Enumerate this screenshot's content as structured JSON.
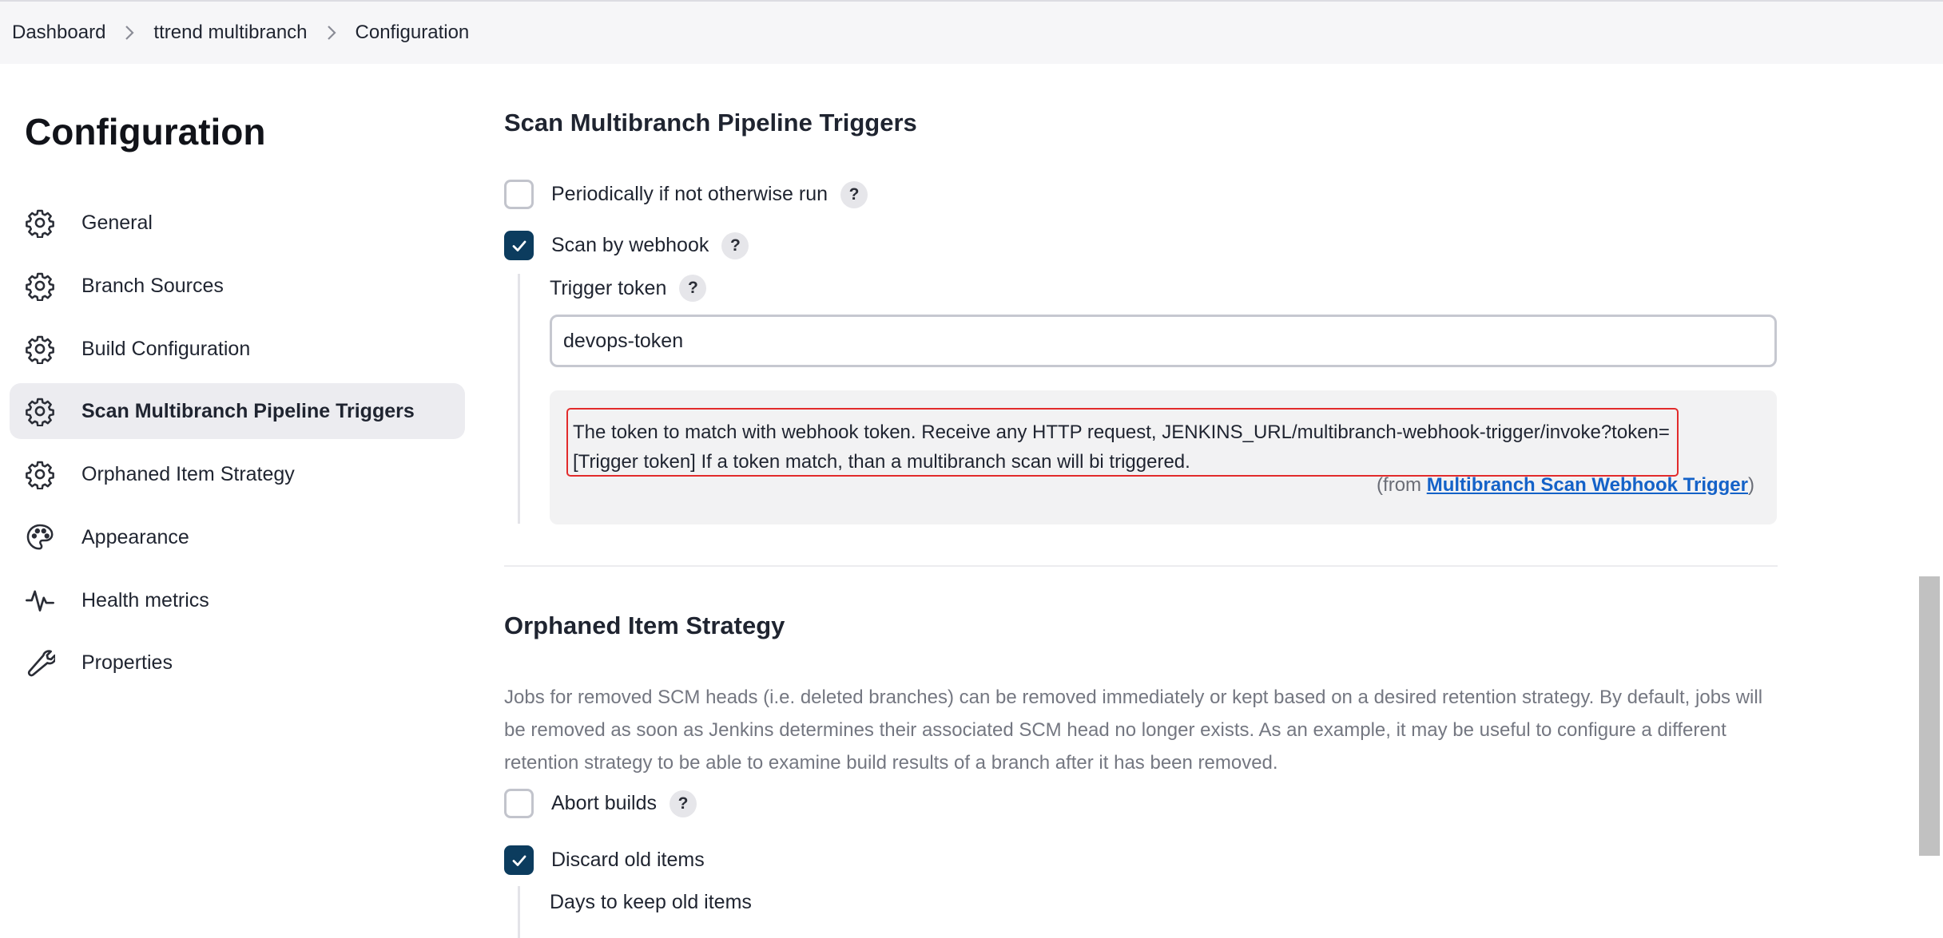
{
  "breadcrumb": {
    "items": [
      "Dashboard",
      "ttrend multibranch",
      "Configuration"
    ]
  },
  "sidebar": {
    "title": "Configuration",
    "items": [
      {
        "label": "General",
        "icon": "gear-icon"
      },
      {
        "label": "Branch Sources",
        "icon": "gear-icon"
      },
      {
        "label": "Build Configuration",
        "icon": "gear-icon"
      },
      {
        "label": "Scan Multibranch Pipeline Triggers",
        "icon": "gear-icon",
        "active": true
      },
      {
        "label": "Orphaned Item Strategy",
        "icon": "gear-icon"
      },
      {
        "label": "Appearance",
        "icon": "palette-icon"
      },
      {
        "label": "Health metrics",
        "icon": "pulse-icon"
      },
      {
        "label": "Properties",
        "icon": "wrench-icon"
      }
    ]
  },
  "triggers": {
    "title": "Scan Multibranch Pipeline Triggers",
    "periodically": {
      "label": "Periodically if not otherwise run",
      "checked": false
    },
    "webhook": {
      "label": "Scan by webhook",
      "checked": true
    },
    "token_label": "Trigger token",
    "token_value": "devops-token",
    "help_line1": "The token to match with webhook token. Receive any HTTP request, JENKINS_URL/multibranch-webhook-trigger/invoke?token=",
    "help_line2": "[Trigger token] If a token match, than a multibranch scan will bi triggered.",
    "from_prefix": "(from ",
    "from_link": "Multibranch Scan Webhook Trigger",
    "from_suffix": ")"
  },
  "orphaned": {
    "title": "Orphaned Item Strategy",
    "description": "Jobs for removed SCM heads (i.e. deleted branches) can be removed immediately or kept based on a desired retention strategy. By default, jobs will be removed as soon as Jenkins determines their associated SCM head no longer exists. As an example, it may be useful to configure a different retention strategy to be able to examine build results of a branch after it has been removed.",
    "abort": {
      "label": "Abort builds",
      "checked": false
    },
    "discard": {
      "label": "Discard old items",
      "checked": true
    },
    "days_label": "Days to keep old items"
  },
  "help_glyph": "?",
  "colors": {
    "accent": "#0c3c5e",
    "link": "#1462c8",
    "highlight_border": "#e22b2b"
  }
}
